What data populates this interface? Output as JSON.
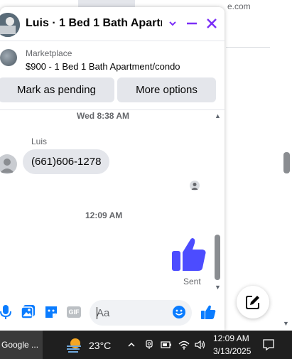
{
  "background": {
    "partial_text": "e.com"
  },
  "chat": {
    "title": "Luis · 1 Bed 1 Bath Apartm…",
    "listing": {
      "source": "Marketplace",
      "title": "$900 - 1 Bed 1 Bath Apartment/condo"
    },
    "actions": {
      "mark_pending": "Mark as pending",
      "more_options": "More options"
    },
    "messages": {
      "timestamp_1": "Wed 8:38 AM",
      "sender_name": "Luis",
      "received_text": "(661)606-1278",
      "timestamp_2": "12:09 AM",
      "sent_status": "Sent"
    },
    "composer": {
      "placeholder": "Aa",
      "gif_label": "GIF"
    },
    "colors": {
      "accent": "#7b2ff7",
      "messenger_blue": "#0a7cff",
      "thumb_blue": "#4c4cff"
    }
  },
  "taskbar": {
    "app_label": "Google ...",
    "temperature": "23°C",
    "time": "12:09 AM",
    "date": "3/13/2025"
  }
}
